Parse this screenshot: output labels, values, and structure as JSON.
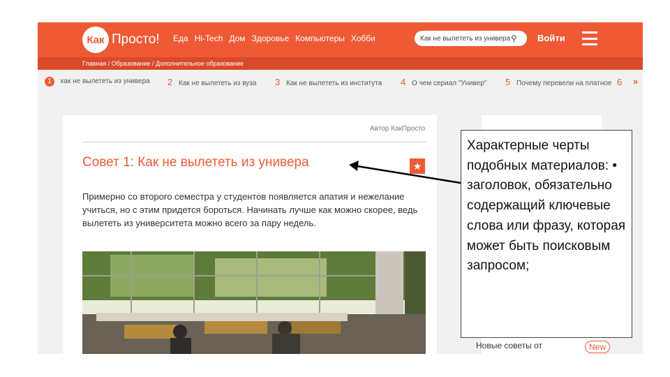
{
  "site": {
    "logo_mark": "Как",
    "logo_text": "Просто!",
    "nav": [
      "Еда",
      "Hi-Tech",
      "Дом",
      "Здоровье",
      "Компьютеры",
      "Хобби"
    ],
    "search_placeholder": "Как не вылететь из универа",
    "login_label": "Войти",
    "breadcrumbs": "Главная / Образование / Дополнительное образование",
    "brand_color": "#ee5a36"
  },
  "tips": [
    {
      "num": "1",
      "label": "как не вылететь из универа"
    },
    {
      "num": "2",
      "label": "Как не вылететь из вуза"
    },
    {
      "num": "3",
      "label": "Как не вылететь из института"
    },
    {
      "num": "4",
      "label": "О чем сериал \"Универ\""
    },
    {
      "num": "5",
      "label": "Почему перевели на платное"
    },
    {
      "num": "6",
      "label": ""
    }
  ],
  "tips_more": "»",
  "article": {
    "author": "Автор КакПросто",
    "title": "Совет 1: Как не вылететь из универа",
    "lead": "Примерно со второго семестра у студентов появляется апатия и нежелание учиться, но с этим придется бороться. Начинать лучше как можно скорее, ведь вылететь из университета можно всего за пару недель."
  },
  "sidebar": {
    "new_tips": "Новые советы от",
    "new_badge": "New"
  },
  "callout": {
    "text": "Характерные черты подобных материалов: • заголовок, обязательно содержащий ключевые слова или фразу, которая может быть поисковым запросом;"
  }
}
